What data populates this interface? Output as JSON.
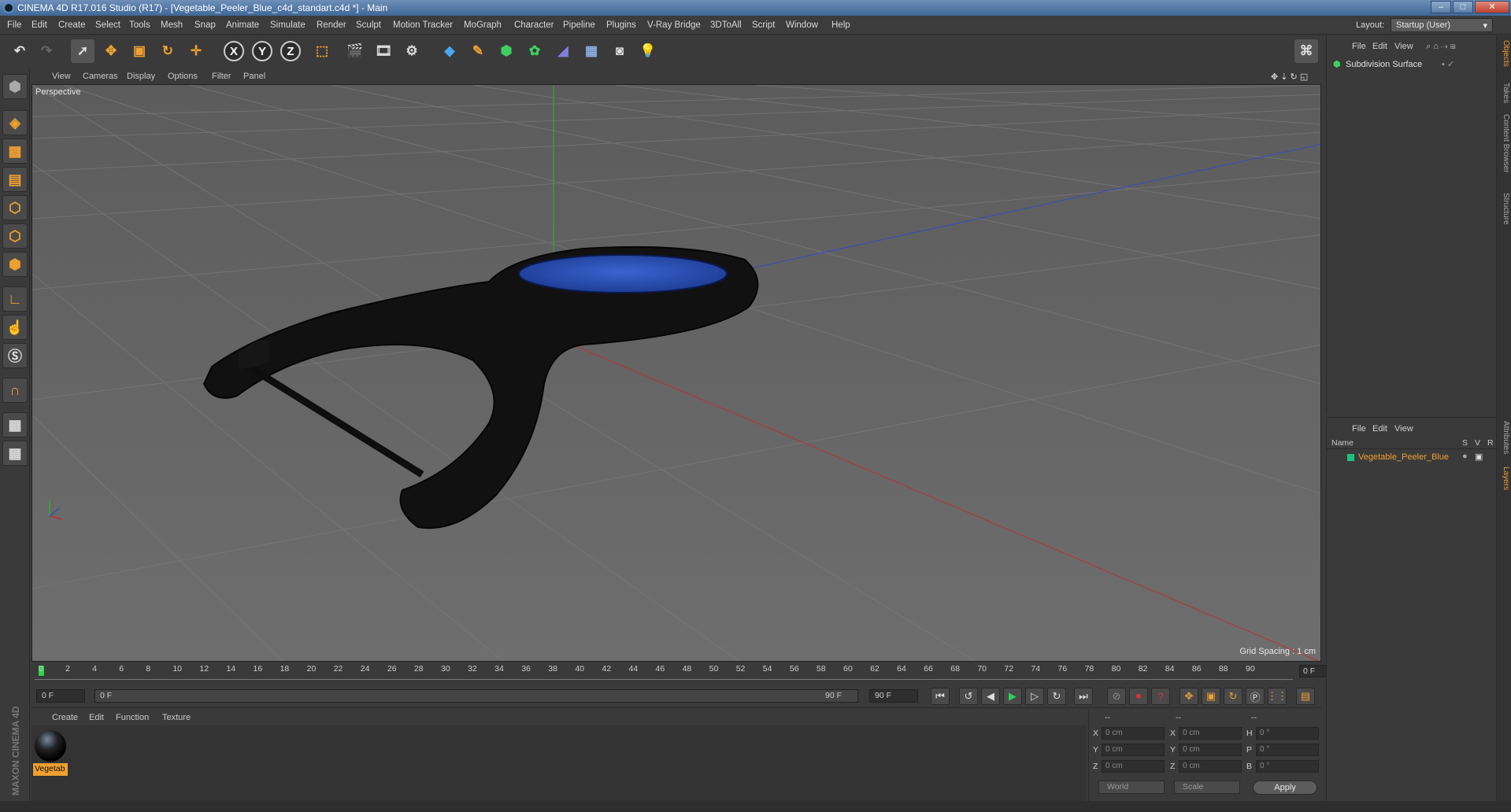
{
  "window": {
    "title": "CINEMA 4D R17.016 Studio (R17) - [Vegetable_Peeler_Blue_c4d_standart.c4d *] - Main",
    "controls": [
      "–",
      "□",
      "✕"
    ]
  },
  "menubar": {
    "items": [
      "File",
      "Edit",
      "Create",
      "Select",
      "Tools",
      "Mesh",
      "Snap",
      "Animate",
      "Simulate",
      "Render",
      "Sculpt",
      "Motion Tracker",
      "MoGraph",
      "Character",
      "Pipeline",
      "Plugins",
      "V-Ray Bridge",
      "3DToAll",
      "Script",
      "Window",
      "Help"
    ],
    "layout_label": "Layout:",
    "layout_value": "Startup (User)"
  },
  "toolbar": {
    "axis_x": "X",
    "axis_y": "Y",
    "axis_z": "Z"
  },
  "viewport": {
    "menu": [
      "View",
      "Cameras",
      "Display",
      "Options",
      "Filter",
      "Panel"
    ],
    "label": "Perspective",
    "grid_spacing": "Grid Spacing : 1 cm"
  },
  "timeline": {
    "ticks": [
      "0",
      "2",
      "4",
      "6",
      "8",
      "10",
      "12",
      "14",
      "16",
      "18",
      "20",
      "22",
      "24",
      "26",
      "28",
      "30",
      "32",
      "34",
      "36",
      "38",
      "40",
      "42",
      "44",
      "46",
      "48",
      "50",
      "52",
      "54",
      "56",
      "58",
      "60",
      "62",
      "64",
      "66",
      "68",
      "70",
      "72",
      "74",
      "76",
      "78",
      "80",
      "82",
      "84",
      "86",
      "88",
      "90"
    ],
    "current_frame": "0 F",
    "start_field": "0 F",
    "range_start": "0 F",
    "range_end": "90 F",
    "end_field": "90 F"
  },
  "material_manager": {
    "menu": [
      "Create",
      "Edit",
      "Function",
      "Texture"
    ],
    "material_name": "Vegetab"
  },
  "coordinates": {
    "headers": [
      "--",
      "--",
      "--"
    ],
    "rows": [
      {
        "l1": "X",
        "v1": "0 cm",
        "l2": "X",
        "v2": "0 cm",
        "l3": "H",
        "v3": "0 °"
      },
      {
        "l1": "Y",
        "v1": "0 cm",
        "l2": "Y",
        "v2": "0 cm",
        "l3": "P",
        "v3": "0 °"
      },
      {
        "l1": "Z",
        "v1": "0 cm",
        "l2": "Z",
        "v2": "0 cm",
        "l3": "B",
        "v3": "0 °"
      }
    ],
    "mode_world": "World",
    "mode_scale": "Scale",
    "apply_label": "Apply"
  },
  "object_manager": {
    "menu": [
      "File",
      "Edit",
      "View"
    ],
    "object_name": "Subdivision Surface"
  },
  "layers_manager": {
    "menu": [
      "File",
      "Edit",
      "View"
    ],
    "col_name": "Name",
    "col_s": "S",
    "col_v": "V",
    "col_r": "R",
    "layer_name": "Vegetable_Peeler_Blue",
    "layer_color": "#20c080"
  },
  "right_tabs": [
    "Objects",
    "Takes",
    "Content Browser",
    "Structure",
    "Attributes",
    "Layers"
  ],
  "brand": "MAXON CINEMA 4D",
  "colors": {
    "accent": "#f0a030",
    "axis_x": "#c03030",
    "axis_y": "#30a030",
    "axis_z": "#3050c0",
    "peeler_blue": "#2a4fb0"
  }
}
